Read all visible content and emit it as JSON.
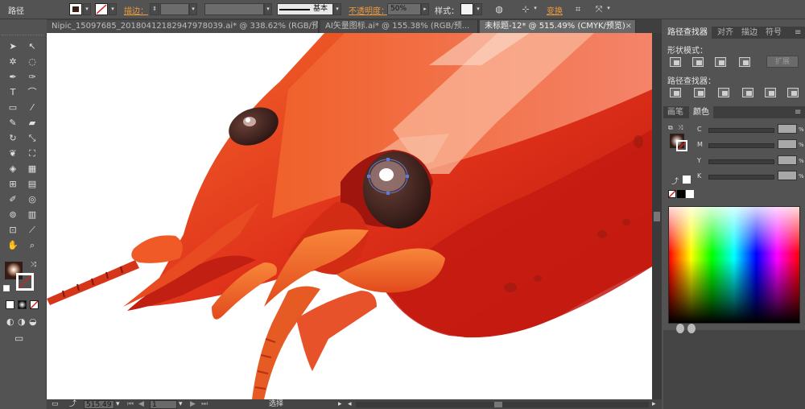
{
  "control_bar": {
    "path_label": "路径",
    "stroke_label": "描边：",
    "brush_label": "基本",
    "opacity_label": "不透明度：",
    "opacity_value": "50%",
    "style_label": "样式：",
    "transform_label": "变换",
    "fill_color": "#ffffff",
    "stroke_color": "#cc2222"
  },
  "tabs": [
    {
      "label": "Nipic_15097685_20180412182947978039.ai* @ 338.62% (RGB/预...",
      "active": false
    },
    {
      "label": "AI矢量图标.ai* @ 155.38% (RGB/预...",
      "active": false
    },
    {
      "label": "未标题-12* @ 515.49% (CMYK/预览)",
      "active": true
    }
  ],
  "tools": [
    {
      "name": "selection-tool-icon",
      "glyph": "➤"
    },
    {
      "name": "direct-selection-tool-icon",
      "glyph": "↖"
    },
    {
      "name": "magic-wand-tool-icon",
      "glyph": "✲"
    },
    {
      "name": "lasso-tool-icon",
      "glyph": "◌"
    },
    {
      "name": "pen-tool-icon",
      "glyph": "✒"
    },
    {
      "name": "curvature-tool-icon",
      "glyph": "✑"
    },
    {
      "name": "type-tool-icon",
      "glyph": "T"
    },
    {
      "name": "arc-tool-icon",
      "glyph": "⌒"
    },
    {
      "name": "rectangle-tool-icon",
      "glyph": "▭"
    },
    {
      "name": "paintbrush-tool-icon",
      "glyph": "⁄"
    },
    {
      "name": "pencil-tool-icon",
      "glyph": "✎"
    },
    {
      "name": "eraser-tool-icon",
      "glyph": "▰"
    },
    {
      "name": "rotate-tool-icon",
      "glyph": "↻"
    },
    {
      "name": "scale-tool-icon",
      "glyph": "⤡"
    },
    {
      "name": "warp-tool-icon",
      "glyph": "❦"
    },
    {
      "name": "free-transform-tool-icon",
      "glyph": "⛶"
    },
    {
      "name": "shape-builder-tool-icon",
      "glyph": "◈"
    },
    {
      "name": "perspective-grid-tool-icon",
      "glyph": "▦"
    },
    {
      "name": "mesh-tool-icon",
      "glyph": "⊞"
    },
    {
      "name": "gradient-tool-icon",
      "glyph": "▤"
    },
    {
      "name": "eyedropper-tool-icon",
      "glyph": "✐"
    },
    {
      "name": "blend-tool-icon",
      "glyph": "◎"
    },
    {
      "name": "symbol-sprayer-tool-icon",
      "glyph": "⊚"
    },
    {
      "name": "column-graph-tool-icon",
      "glyph": "▥"
    },
    {
      "name": "artboard-tool-icon",
      "glyph": "⊡"
    },
    {
      "name": "slice-tool-icon",
      "glyph": "⟋"
    },
    {
      "name": "hand-tool-icon",
      "glyph": "✋"
    },
    {
      "name": "zoom-tool-icon",
      "glyph": "⌕"
    }
  ],
  "status_bar": {
    "zoom": "515.49",
    "artboard": "1",
    "tool_name": "选择"
  },
  "pathfinder": {
    "tabs": [
      "路径查找器",
      "对齐",
      "描边",
      "符号"
    ],
    "shape_modes_label": "形状模式：",
    "pathfinders_label": "路径查找器：",
    "expand_label": "扩展"
  },
  "color_panel": {
    "tabs": [
      "画笔",
      "颜色"
    ],
    "channels": [
      "C",
      "M",
      "Y",
      "K"
    ],
    "percent": "%"
  }
}
